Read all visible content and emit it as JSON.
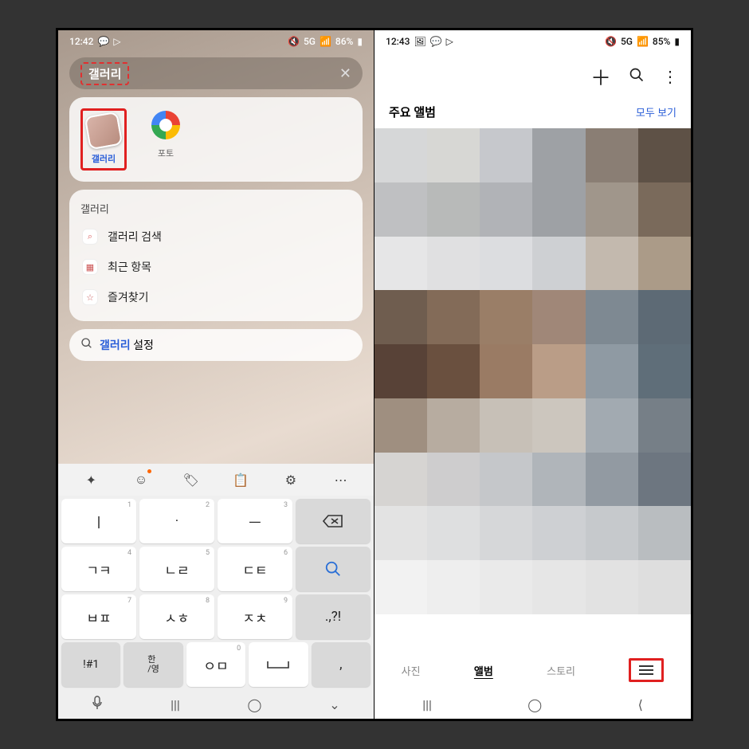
{
  "left": {
    "status": {
      "time": "12:42",
      "battery": "86%",
      "net": "5G"
    },
    "search_query": "갤러리",
    "apps": [
      {
        "label": "갤러리",
        "icon": "gallery-icon",
        "highlight": true
      },
      {
        "label": "포토",
        "icon": "google-photos-icon",
        "highlight": false
      }
    ],
    "section_title": "갤러리",
    "actions": [
      {
        "label": "갤러리 검색",
        "icon": "search-icon"
      },
      {
        "label": "최근 항목",
        "icon": "grid-icon"
      },
      {
        "label": "즐겨찾기",
        "icon": "star-icon"
      }
    ],
    "suggestion": {
      "highlight": "갤러리",
      "rest": " 설정"
    },
    "keyboard": {
      "toolbar": [
        "ai-icon",
        "emoji-icon",
        "sticker-icon",
        "clipboard-icon",
        "settings-icon",
        "more-icon"
      ],
      "rows": [
        [
          {
            "main": "ㅣ",
            "sup": "1"
          },
          {
            "main": "·",
            "sup": "2"
          },
          {
            "main": "ㅡ",
            "sup": "3"
          },
          {
            "main": "del",
            "grey": true
          }
        ],
        [
          {
            "main": "ㄱㅋ",
            "sup": "4"
          },
          {
            "main": "ㄴㄹ",
            "sup": "5"
          },
          {
            "main": "ㄷㅌ",
            "sup": "6"
          },
          {
            "main": "search",
            "grey": true,
            "blue": true
          }
        ],
        [
          {
            "main": "ㅂㅍ",
            "sup": "7"
          },
          {
            "main": "ㅅㅎ",
            "sup": "8"
          },
          {
            "main": "ㅈㅊ",
            "sup": "9"
          },
          {
            "main": ".,?!",
            "grey": true
          }
        ],
        [
          {
            "main": "!#1",
            "grey": true
          },
          {
            "main": "한/영",
            "grey": true,
            "small": true
          },
          {
            "main": "ㅇㅁ",
            "sup": "0"
          },
          {
            "main": "space"
          },
          {
            "main": ",",
            "grey": true
          }
        ]
      ]
    },
    "nav": [
      "mic-icon",
      "recent-icon",
      "home-icon",
      "dropdown-icon"
    ]
  },
  "right": {
    "status": {
      "time": "12:43",
      "battery": "85%",
      "net": "5G"
    },
    "header_icons": [
      "plus-icon",
      "search-icon",
      "more-vert-icon"
    ],
    "sub_title": "주요 앨범",
    "see_all": "모두 보기",
    "mosaic_colors": [
      "#d6d7d8",
      "#d7d7d4",
      "#c6c8cc",
      "#9ea1a5",
      "#8a7e74",
      "#5e5146",
      "#bfc0c2",
      "#b8bab9",
      "#b1b3b7",
      "#9ea1a5",
      "#a0968b",
      "#7a6a5b",
      "#e6e6e7",
      "#e0e0e1",
      "#dcdde0",
      "#ced0d3",
      "#c3b9ae",
      "#ab9b88",
      "#6f5d4f",
      "#836b58",
      "#9a7e67",
      "#a08778",
      "#7e8992",
      "#5d6a75",
      "#584237",
      "#6a503f",
      "#9a7b64",
      "#ba9d87",
      "#8f9aa3",
      "#5f6e79",
      "#9f8f80",
      "#b7aca0",
      "#c7c0b7",
      "#ccc6be",
      "#a2aab1",
      "#767f87",
      "#d6d4d2",
      "#cecdce",
      "#c5c7ca",
      "#b0b5ba",
      "#929aa2",
      "#6d7680",
      "#e3e3e3",
      "#dedfe0",
      "#d6d7d9",
      "#ced0d3",
      "#c6c9cc",
      "#b9bdc0",
      "#f2f2f2",
      "#eeeeee",
      "#eaeaea",
      "#e6e6e6",
      "#e2e2e2",
      "#dedede"
    ],
    "tabs": [
      {
        "label": "사진",
        "active": false
      },
      {
        "label": "앨범",
        "active": true
      },
      {
        "label": "스토리",
        "active": false
      }
    ],
    "menu_icon": "hamburger-icon",
    "nav": [
      "recent-icon",
      "home-icon",
      "back-icon"
    ]
  }
}
